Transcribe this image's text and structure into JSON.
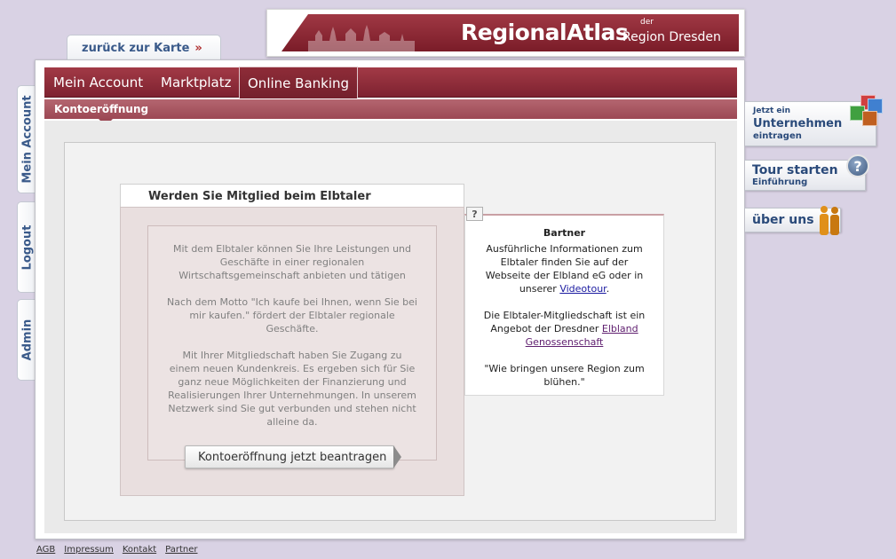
{
  "back_tab": {
    "label": "zurück zur Karte"
  },
  "banner": {
    "title": "RegionalAtlas",
    "der": "der",
    "region": "Region Dresden"
  },
  "nav": {
    "tabs": [
      {
        "label": "Mein Account"
      },
      {
        "label": "Marktplatz"
      },
      {
        "label": "Online Banking"
      }
    ],
    "sub_label": "Kontoeröffnung"
  },
  "left_tabs": [
    {
      "label": "Mein Account"
    },
    {
      "label": "Logout"
    },
    {
      "label": "Admin"
    }
  ],
  "member": {
    "title": "Werden Sie Mitglied beim Elbtaler",
    "paragraphs": [
      "Mit dem Elbtaler können Sie Ihre Leistungen und Geschäfte in einer regionalen Wirtschaftsgemeinschaft anbieten und tätigen",
      "Nach dem Motto \"Ich kaufe bei Ihnen, wenn Sie bei mir kaufen.\" fördert der Elbtaler regionale Geschäfte.",
      "Mit Ihrer Mitgliedschaft haben Sie Zugang zu einem neuen Kundenkreis. Es ergeben sich für Sie ganz neue Möglichkeiten der Finanzierung und Realisierungen Ihrer Unternehmungen. In unserem Netzwerk sind Sie gut verbunden und stehen nicht alleine da."
    ],
    "apply_button": "Kontoeröffnung jetzt beantragen"
  },
  "help": {
    "label": "?"
  },
  "bartner": {
    "title": "Bartner",
    "p1_text": "Ausführliche Informationen zum Elbtaler finden Sie auf der Webseite der Elbland eG oder in unserer ",
    "p1_link": "Videotour",
    "p1_end": ".",
    "p2_text": "Die Elbtaler-Mitgliedschaft ist ein Angebot der Dresdner ",
    "p2_link": "Elbland Genossenschaft",
    "p3_text": "\"Wie bringen unsere Region zum blühen.\""
  },
  "side": {
    "unternehmen": {
      "line1": "Jetzt ein",
      "line2": "Unternehmen",
      "line3": "eintragen"
    },
    "tour": {
      "line1": "Tour starten",
      "line2": "Einführung",
      "icon_label": "?"
    },
    "about": {
      "line1": "über uns"
    }
  },
  "footer": {
    "links": [
      {
        "label": "AGB"
      },
      {
        "label": "Impressum"
      },
      {
        "label": "Kontakt"
      },
      {
        "label": "Partner"
      }
    ]
  },
  "colors": {
    "brand": "#8a2a36",
    "sub_bar": "#a85a64",
    "background": "#d9d2e4",
    "link": "#1a1aa0",
    "nav_text": "#3a5a8a"
  }
}
